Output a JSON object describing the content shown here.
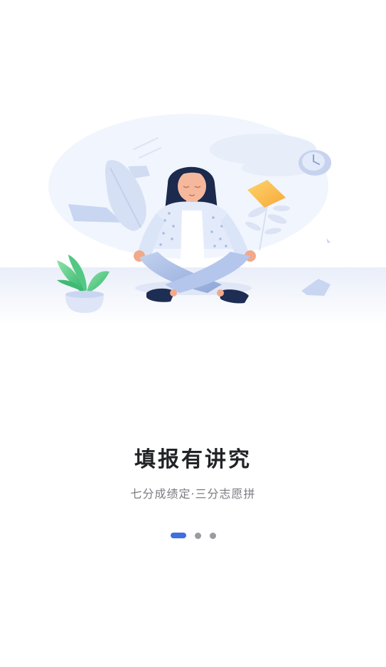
{
  "onboarding": {
    "illustration_icon": "meditation-illustration",
    "title": "填报有讲究",
    "subtitle": "七分成绩定·三分志愿拼",
    "pager": {
      "total": 3,
      "active_index": 0,
      "active_color": "#3f6fe0",
      "inactive_color": "#9a9ba0"
    }
  }
}
